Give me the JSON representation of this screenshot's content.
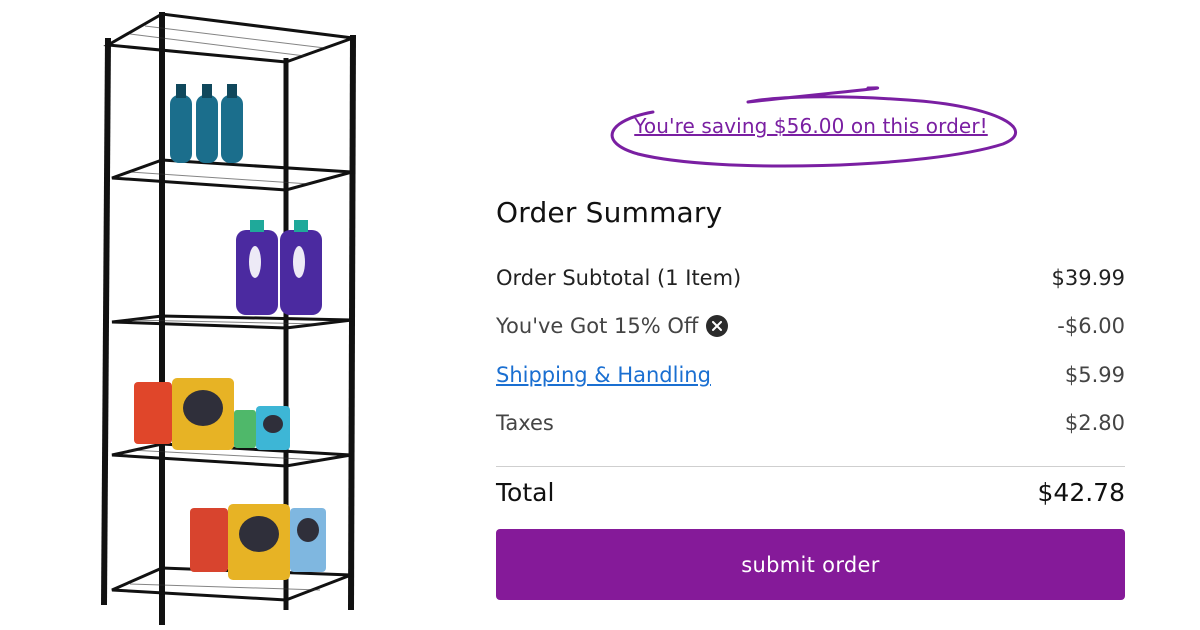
{
  "savings": {
    "text": "You're saving $56.00 on this order!"
  },
  "summary": {
    "title": "Order Summary",
    "rows": [
      {
        "label": "Order Subtotal (1 Item)",
        "amount": "$39.99"
      },
      {
        "label": "You've Got 15% Off",
        "amount": "-$6.00"
      },
      {
        "label": "Shipping & Handling",
        "amount": "$5.99"
      },
      {
        "label": "Taxes",
        "amount": "$2.80"
      }
    ],
    "total": {
      "label": "Total",
      "amount": "$42.78"
    }
  },
  "actions": {
    "submit_label": "submit order"
  },
  "colors": {
    "accent": "#851a99",
    "link": "#1a6fd1",
    "savings": "#7a1fa2"
  },
  "icons": {
    "discount_remove": "close-circle-icon"
  }
}
